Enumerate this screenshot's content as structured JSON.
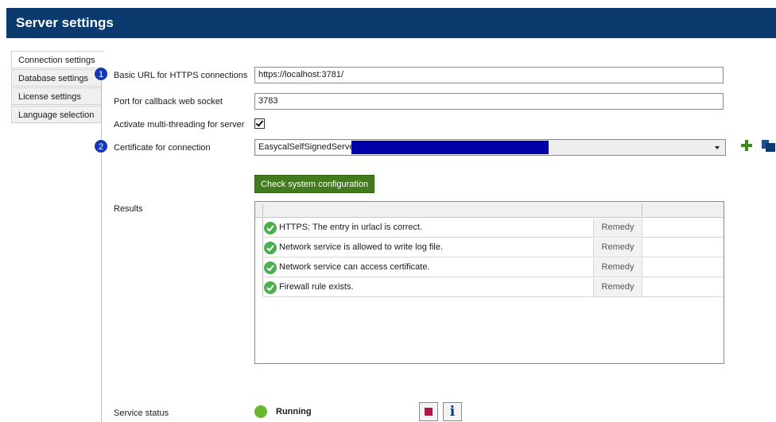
{
  "window": {
    "title": "Server settings"
  },
  "nav": {
    "items": [
      {
        "label": "Connection settings",
        "active": true
      },
      {
        "label": "Database settings",
        "active": false
      },
      {
        "label": "License settings",
        "active": false
      },
      {
        "label": "Language selection",
        "active": false
      }
    ]
  },
  "form": {
    "https_url": {
      "badge": "1",
      "label": "Basic URL for HTTPS connections",
      "value": "https://localhost:3781/"
    },
    "callback_port": {
      "label": "Port for callback web socket",
      "value": "3783"
    },
    "multithreading": {
      "label": "Activate multi-threading for server",
      "checked": true
    },
    "certificate": {
      "badge": "2",
      "label": "Certificate for connection",
      "value": "EasycalSelfSignedServer"
    }
  },
  "actions": {
    "check_system": "Check system configuration"
  },
  "results": {
    "label": "Results",
    "rows": [
      {
        "status": "ok",
        "message": "HTTPS: The entry in urlacl is correct.",
        "action": "Remedy"
      },
      {
        "status": "ok",
        "message": "Network service is allowed to write log file.",
        "action": "Remedy"
      },
      {
        "status": "ok",
        "message": "Network service can access certificate.",
        "action": "Remedy"
      },
      {
        "status": "ok",
        "message": "Firewall rule exists.",
        "action": "Remedy"
      }
    ]
  },
  "service": {
    "label": "Service status",
    "status": "Running",
    "status_color": "#6bb82f"
  },
  "colors": {
    "header": "#0b3a6e",
    "accent_button": "#437a1e",
    "badge": "#1437b8",
    "stop": "#b5124d"
  },
  "icons": {
    "add": "plus-icon",
    "copy": "copy-icon",
    "ok": "check-circle-icon",
    "stop": "stop-icon",
    "info": "info-icon"
  }
}
